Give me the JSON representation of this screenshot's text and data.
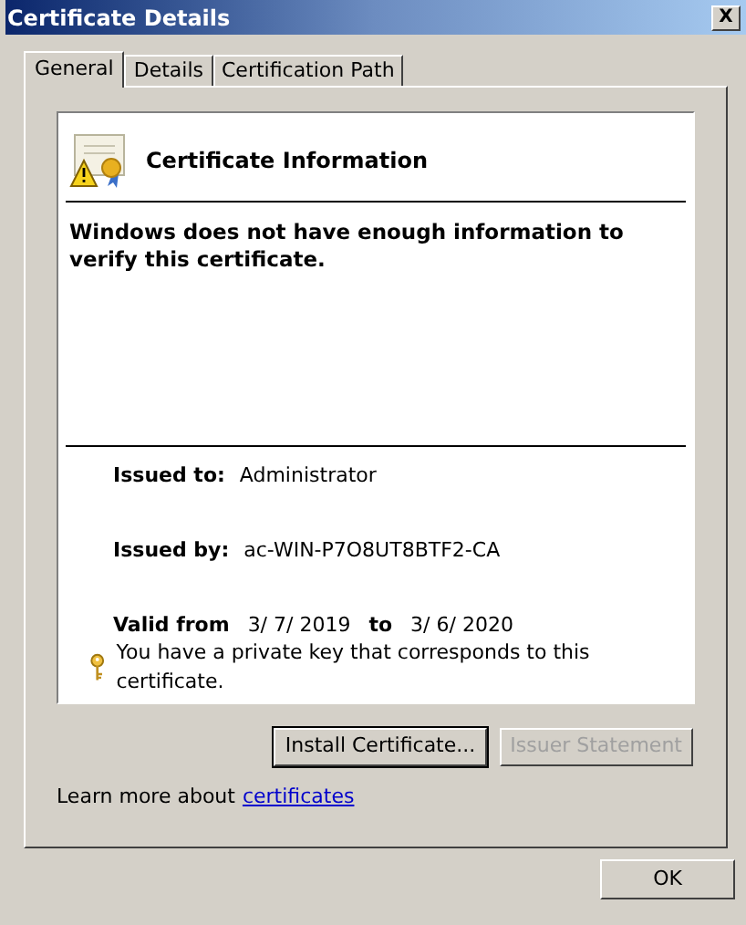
{
  "window": {
    "title": "Certificate Details",
    "close": "X"
  },
  "tabs": [
    {
      "label": "General",
      "selected": true
    },
    {
      "label": "Details",
      "selected": false
    },
    {
      "label": "Certification Path",
      "selected": false
    }
  ],
  "info": {
    "heading": "Certificate Information",
    "message": "Windows does not have enough information to verify this certificate."
  },
  "fields": [
    {
      "label": "Issued to:",
      "value": "Administrator"
    },
    {
      "label": "Issued by:",
      "value": "ac-WIN-P7O8UT8BTF2-CA"
    }
  ],
  "validity": {
    "from_label": "Valid from",
    "from": "3/ 7/ 2019",
    "to_label": "to",
    "to": "3/ 6/ 2020"
  },
  "private_key_note": "You have a private key that corresponds to this certificate.",
  "buttons": [
    {
      "label": "Install Certificate...",
      "disabled": false,
      "default": true
    },
    {
      "label": "Issuer Statement",
      "disabled": true,
      "default": false
    }
  ],
  "learn_more": {
    "text": "Learn more about",
    "link": "certificates"
  },
  "ok_button": "OK"
}
